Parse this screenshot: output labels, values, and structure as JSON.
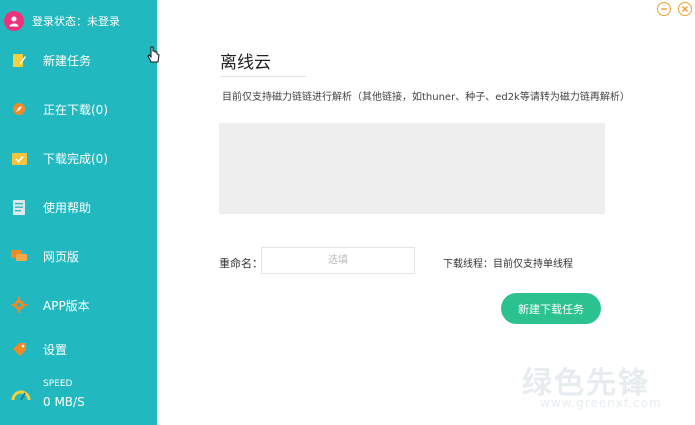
{
  "sidebar": {
    "login_status": "登录状态：未登录",
    "items": [
      {
        "label": "新建任务",
        "icon": "pencil-note-icon",
        "icon_color": "#f3d03e"
      },
      {
        "label": "正在下载(0)",
        "icon": "compass-icon",
        "icon_color": "#f08a24"
      },
      {
        "label": "下载完成(0)",
        "icon": "check-folder-icon",
        "icon_color": "#f3c43e"
      },
      {
        "label": "使用帮助",
        "icon": "document-icon",
        "icon_color": "#dfe7ea"
      },
      {
        "label": "网页版",
        "icon": "chat-icon",
        "icon_color": "#f08a24"
      },
      {
        "label": "APP版本",
        "icon": "gear-icon",
        "icon_color": "#f08a24"
      },
      {
        "label": "设置",
        "icon": "tag-icon",
        "icon_color": "#f08a24"
      }
    ],
    "speed": {
      "title": "SPEED",
      "value": "0 MB/S",
      "icon": "speedometer-icon"
    }
  },
  "window": {
    "min_icon": "minimize-icon",
    "close_icon": "close-icon"
  },
  "main": {
    "title": "离线云",
    "hint": "目前仅支持磁力链链进行解析（其他链接，如thuner、种子、ed2k等请转为磁力链再解析）",
    "link_value": "",
    "rename_label": "重命名：",
    "rename_placeholder": "选填",
    "rename_value": "",
    "thread_note": "下载线程：目前仅支持单线程",
    "create_button": "新建下载任务"
  },
  "watermark": {
    "text": "绿色先锋",
    "sub": "www.greenxf.com"
  },
  "colors": {
    "sidebar": "#22b8c0",
    "accent_button": "#2bc290",
    "avatar": "#f0327c",
    "window_controls": "#f0a030"
  }
}
